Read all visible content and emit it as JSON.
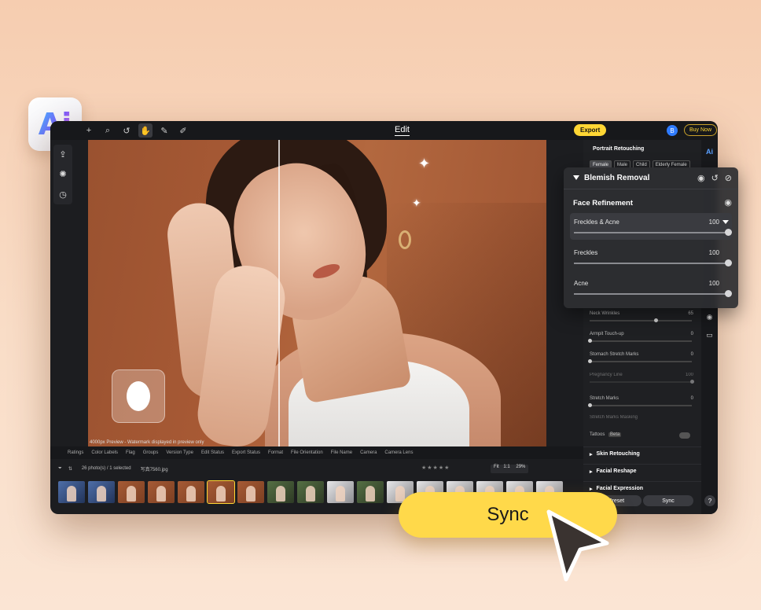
{
  "badge": {
    "label": "Ai"
  },
  "toolbar": {
    "title": "Edit",
    "export_label": "Export",
    "avatar_letter": "B",
    "buy_label": "Buy Now"
  },
  "canvas": {
    "watermark_note": "4000px Preview - Watermark displayed in preview only"
  },
  "right_panel": {
    "title": "Portrait Retouching",
    "side_rail_label": "Ai",
    "chips": [
      "Female",
      "Male",
      "Child",
      "Elderly Female"
    ],
    "rows": [
      {
        "label": "Neck Wrinkles",
        "value": "65",
        "level": 0.65
      },
      {
        "label": "Armpit Touch-up",
        "value": "0",
        "level": 0.0
      },
      {
        "label": "Stomach Stretch Marks",
        "value": "0",
        "level": 0.0
      },
      {
        "label": "Pregnancy Line",
        "value": "100",
        "level": 1.0
      },
      {
        "label": "Stretch Marks",
        "value": "0",
        "level": 0.0
      },
      {
        "label": "Stretch Marks Masking",
        "value": "",
        "level": 0.0
      }
    ],
    "tattoos_label": "Tattoos",
    "tattoos_badge": "Beta",
    "sections": [
      "Skin Retouching",
      "Facial Reshape",
      "Facial Expression"
    ],
    "preset_label": "Preset",
    "sync_label": "Sync"
  },
  "blemish": {
    "title": "Blemish Removal",
    "subtitle": "Face Refinement",
    "sliders": [
      {
        "label": "Freckles & Acne",
        "value": "100",
        "level": 1.0,
        "highlight": true
      },
      {
        "label": "Freckles",
        "value": "100",
        "level": 1.0,
        "highlight": false
      },
      {
        "label": "Acne",
        "value": "100",
        "level": 1.0,
        "highlight": false
      }
    ]
  },
  "filter_bar": [
    "Ratings",
    "Color Labels",
    "Flag",
    "Groups",
    "Version Type",
    "Edit Status",
    "Export Status",
    "Format",
    "File Orientation",
    "File Name",
    "Camera",
    "Camera Lens"
  ],
  "info_bar": {
    "count": "26 photo(s) / 1 selected",
    "filename": "写真7560.jpg",
    "fit": "Fit",
    "ratio": "1:1",
    "zoom": "29%"
  },
  "sync_button": {
    "label": "Sync"
  },
  "colors": {
    "accent": "#ffd634",
    "panel": "#1f2023",
    "background": "#f6cdb0"
  }
}
